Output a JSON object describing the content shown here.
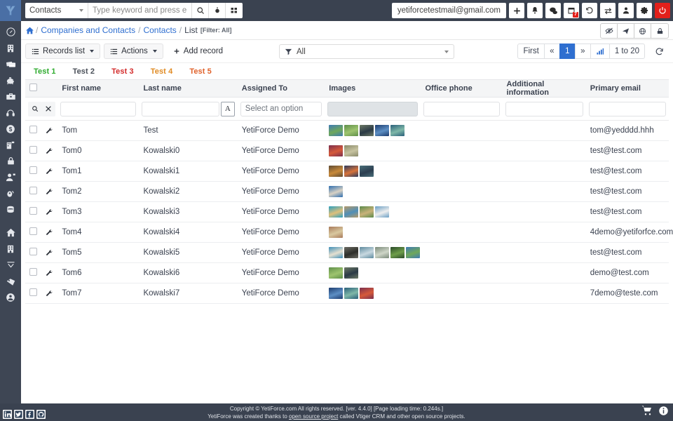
{
  "topbar": {
    "logo_icon": "yetiforce-logo-icon",
    "module_select": {
      "value": "Contacts",
      "icon": "chevron-down-icon"
    },
    "search_placeholder": "Type keyword and press enter",
    "search_value": "",
    "buttons": [
      {
        "name": "search-icon",
        "label": ""
      },
      {
        "name": "target-icon",
        "label": ""
      },
      {
        "name": "grid-icon",
        "label": ""
      }
    ],
    "user_email": "yetiforcetestmail@gmail.com",
    "right_icons": [
      {
        "name": "add-icon",
        "glyph": "+"
      },
      {
        "name": "bell-icon",
        "glyph": ""
      },
      {
        "name": "chat-icon",
        "glyph": ""
      },
      {
        "name": "calendar-icon",
        "glyph": "",
        "badge": "7"
      },
      {
        "name": "history-icon",
        "glyph": ""
      },
      {
        "name": "switch-icon",
        "glyph": ""
      },
      {
        "name": "user-icon",
        "glyph": ""
      },
      {
        "name": "gear-icon",
        "glyph": ""
      },
      {
        "name": "power-icon",
        "glyph": ""
      }
    ]
  },
  "sidebar": {
    "items": [
      {
        "name": "sidebar-item-dashboard",
        "icon": "gauge-icon"
      },
      {
        "name": "sidebar-item-companies",
        "icon": "building-icon"
      },
      {
        "name": "sidebar-item-cards",
        "icon": "cards-icon"
      },
      {
        "name": "sidebar-item-finances",
        "icon": "piggy-bank-icon"
      },
      {
        "name": "sidebar-item-sales",
        "icon": "briefcase-icon"
      },
      {
        "name": "sidebar-item-support",
        "icon": "headset-icon"
      },
      {
        "name": "sidebar-item-accounting",
        "icon": "dollar-circle-icon"
      },
      {
        "name": "sidebar-item-organizations",
        "icon": "building-plus-icon"
      },
      {
        "name": "sidebar-item-security",
        "icon": "lock-icon"
      },
      {
        "name": "sidebar-item-users",
        "icon": "user-plus-icon"
      },
      {
        "name": "sidebar-item-helpdesk",
        "icon": "support-icon"
      },
      {
        "name": "sidebar-item-database",
        "icon": "database-icon"
      },
      {
        "name": "sidebar-item-home",
        "icon": "home-icon"
      },
      {
        "name": "sidebar-item-projects",
        "icon": "building2-icon"
      },
      {
        "name": "sidebar-item-filters",
        "icon": "funnel-icon"
      },
      {
        "name": "sidebar-item-tags",
        "icon": "tag-icon"
      },
      {
        "name": "sidebar-item-account",
        "icon": "user-circle-icon"
      }
    ]
  },
  "breadcrumb": {
    "home_icon": "home-icon",
    "items": [
      {
        "label": "Companies and Contacts",
        "link": true
      },
      {
        "label": "Contacts",
        "link": true
      },
      {
        "label": "List",
        "link": false
      }
    ],
    "filter_note": "[Filter: All]",
    "actions": [
      {
        "name": "eye-slash-icon"
      },
      {
        "name": "paper-plane-icon"
      },
      {
        "name": "globe-icon"
      },
      {
        "name": "lock-icon"
      }
    ]
  },
  "toolbar": {
    "records_list_label": "Records list",
    "actions_label": "Actions",
    "add_record_label": "Add record",
    "filter": {
      "icon": "funnel-icon",
      "value": "All"
    },
    "pager": {
      "first_label": "First",
      "prev_label": "«",
      "page_label": "1",
      "next_label": "»",
      "chart_icon": "bar-chart-icon",
      "range_label": "1 to 20",
      "refresh_icon": "refresh-icon"
    }
  },
  "tabs": [
    {
      "label": "Test 1",
      "color": "#2eab2e"
    },
    {
      "label": "Test 2",
      "color": "#4a5059"
    },
    {
      "label": "Test 3",
      "color": "#d32b2b"
    },
    {
      "label": "Test 4",
      "color": "#e08b24"
    },
    {
      "label": "Test 5",
      "color": "#e0622b"
    }
  ],
  "table": {
    "columns": [
      "First name",
      "Last name",
      "Assigned To",
      "Images",
      "Office phone",
      "Additional information",
      "Primary email"
    ],
    "filters": {
      "search_icon": "search-icon",
      "clear_icon": "close-icon",
      "first_name": "",
      "last_name": "",
      "last_name_az": "A",
      "assigned_to_placeholder": "Select an option",
      "images_disabled": true,
      "office_phone": "",
      "additional_information": "",
      "primary_email": ""
    },
    "rows": [
      {
        "first_name": "Tom",
        "last_name": "Test",
        "assigned_to": "YetiForce Demo",
        "images": 5,
        "office_phone": "",
        "additional_information": "",
        "primary_email": "tom@yedddd.hhh"
      },
      {
        "first_name": "Tom0",
        "last_name": "Kowalski0",
        "assigned_to": "YetiForce Demo",
        "images": 2,
        "office_phone": "",
        "additional_information": "",
        "primary_email": "test@test.com"
      },
      {
        "first_name": "Tom1",
        "last_name": "Kowalski1",
        "assigned_to": "YetiForce Demo",
        "images": 3,
        "office_phone": "",
        "additional_information": "",
        "primary_email": "test@test.com"
      },
      {
        "first_name": "Tom2",
        "last_name": "Kowalski2",
        "assigned_to": "YetiForce Demo",
        "images": 1,
        "office_phone": "",
        "additional_information": "",
        "primary_email": "test@test.com"
      },
      {
        "first_name": "Tom3",
        "last_name": "Kowalski3",
        "assigned_to": "YetiForce Demo",
        "images": 4,
        "office_phone": "",
        "additional_information": "",
        "primary_email": "test@test.com"
      },
      {
        "first_name": "Tom4",
        "last_name": "Kowalski4",
        "assigned_to": "YetiForce Demo",
        "images": 1,
        "office_phone": "",
        "additional_information": "",
        "primary_email": "4demo@yetiforfce.com"
      },
      {
        "first_name": "Tom5",
        "last_name": "Kowalski5",
        "assigned_to": "YetiForce Demo",
        "images": 6,
        "office_phone": "",
        "additional_information": "",
        "primary_email": "test@test.com"
      },
      {
        "first_name": "Tom6",
        "last_name": "Kowalski6",
        "assigned_to": "YetiForce Demo",
        "images": 2,
        "office_phone": "",
        "additional_information": "",
        "primary_email": "demo@test.com"
      },
      {
        "first_name": "Tom7",
        "last_name": "Kowalski7",
        "assigned_to": "YetiForce Demo",
        "images": 3,
        "office_phone": "",
        "additional_information": "",
        "primary_email": "7demo@teste.com"
      }
    ]
  },
  "footer": {
    "line1": "Copyright © YetiForce.com All rights reserved. [ver. 4.4.0] [Page loading time: 0.244s.]",
    "line2_before": "YetiForce was created thanks to ",
    "line2_link": "open source project",
    "line2_after": " called Vtiger CRM and other open source projects.",
    "social": [
      "linkedin-icon",
      "twitter-icon",
      "facebook-icon",
      "github-icon"
    ],
    "right_icons": [
      "cart-icon",
      "info-icon"
    ]
  },
  "thumb_palettes": [
    [
      "#3e7ab5,#6fa85a",
      "#5f8f4a,#9ec46f",
      "#6d7a66,#2b3a46",
      "#1d3c6e,#5d8fc4",
      "#2a5f7a,#7fb8a8"
    ],
    [
      "#7b2f4e,#d65a3a",
      "#8a8a6a,#c7c3a0"
    ],
    [
      "#3f7bb0,#8fc46f",
      "#5d4a33,#c98a3a",
      "#2a3a5e,#d8733a"
    ],
    [
      "#4a6f7a,#2c3e50"
    ],
    [
      "#2f6fb0,#d9d2c4",
      "#2aa0c0,#e0c07a",
      "#1f6fae,#d7cfc0",
      "#b59a6a,#4f8fb8"
    ],
    [
      "#1a3f7a,#d9a martial"
    ],
    [
      "#5a8a4a,#c9b27a",
      "#6a9ec4,#ffffff",
      "#a87a5a,#d9c9a0",
      "#3f8fb8,#e6e0d0",
      "#2f7aa8,#c9a77a",
      "#6b6b63,#2e2e2a"
    ],
    [
      "#4a7f9e,#8fc46f",
      "#2f6f4a,#9ec46f"
    ],
    [
      "#5e8a9e,#c8d8e0",
      "#7a8a7a,#cfd6c8",
      "#2a4a2a,#6f9e4a"
    ]
  ]
}
